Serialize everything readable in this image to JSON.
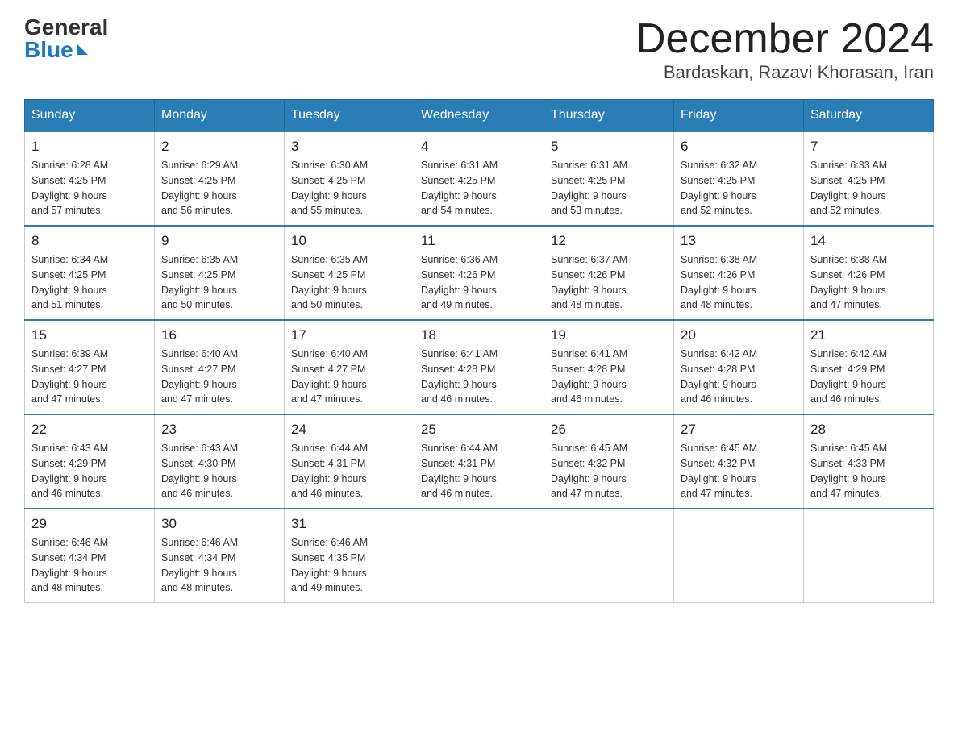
{
  "header": {
    "logo_general": "General",
    "logo_blue": "Blue",
    "month_title": "December 2024",
    "location": "Bardaskan, Razavi Khorasan, Iran"
  },
  "weekdays": [
    "Sunday",
    "Monday",
    "Tuesday",
    "Wednesday",
    "Thursday",
    "Friday",
    "Saturday"
  ],
  "weeks": [
    [
      {
        "day": "1",
        "sunrise": "6:28 AM",
        "sunset": "4:25 PM",
        "daylight": "9 hours and 57 minutes."
      },
      {
        "day": "2",
        "sunrise": "6:29 AM",
        "sunset": "4:25 PM",
        "daylight": "9 hours and 56 minutes."
      },
      {
        "day": "3",
        "sunrise": "6:30 AM",
        "sunset": "4:25 PM",
        "daylight": "9 hours and 55 minutes."
      },
      {
        "day": "4",
        "sunrise": "6:31 AM",
        "sunset": "4:25 PM",
        "daylight": "9 hours and 54 minutes."
      },
      {
        "day": "5",
        "sunrise": "6:31 AM",
        "sunset": "4:25 PM",
        "daylight": "9 hours and 53 minutes."
      },
      {
        "day": "6",
        "sunrise": "6:32 AM",
        "sunset": "4:25 PM",
        "daylight": "9 hours and 52 minutes."
      },
      {
        "day": "7",
        "sunrise": "6:33 AM",
        "sunset": "4:25 PM",
        "daylight": "9 hours and 52 minutes."
      }
    ],
    [
      {
        "day": "8",
        "sunrise": "6:34 AM",
        "sunset": "4:25 PM",
        "daylight": "9 hours and 51 minutes."
      },
      {
        "day": "9",
        "sunrise": "6:35 AM",
        "sunset": "4:25 PM",
        "daylight": "9 hours and 50 minutes."
      },
      {
        "day": "10",
        "sunrise": "6:35 AM",
        "sunset": "4:25 PM",
        "daylight": "9 hours and 50 minutes."
      },
      {
        "day": "11",
        "sunrise": "6:36 AM",
        "sunset": "4:26 PM",
        "daylight": "9 hours and 49 minutes."
      },
      {
        "day": "12",
        "sunrise": "6:37 AM",
        "sunset": "4:26 PM",
        "daylight": "9 hours and 48 minutes."
      },
      {
        "day": "13",
        "sunrise": "6:38 AM",
        "sunset": "4:26 PM",
        "daylight": "9 hours and 48 minutes."
      },
      {
        "day": "14",
        "sunrise": "6:38 AM",
        "sunset": "4:26 PM",
        "daylight": "9 hours and 47 minutes."
      }
    ],
    [
      {
        "day": "15",
        "sunrise": "6:39 AM",
        "sunset": "4:27 PM",
        "daylight": "9 hours and 47 minutes."
      },
      {
        "day": "16",
        "sunrise": "6:40 AM",
        "sunset": "4:27 PM",
        "daylight": "9 hours and 47 minutes."
      },
      {
        "day": "17",
        "sunrise": "6:40 AM",
        "sunset": "4:27 PM",
        "daylight": "9 hours and 47 minutes."
      },
      {
        "day": "18",
        "sunrise": "6:41 AM",
        "sunset": "4:28 PM",
        "daylight": "9 hours and 46 minutes."
      },
      {
        "day": "19",
        "sunrise": "6:41 AM",
        "sunset": "4:28 PM",
        "daylight": "9 hours and 46 minutes."
      },
      {
        "day": "20",
        "sunrise": "6:42 AM",
        "sunset": "4:28 PM",
        "daylight": "9 hours and 46 minutes."
      },
      {
        "day": "21",
        "sunrise": "6:42 AM",
        "sunset": "4:29 PM",
        "daylight": "9 hours and 46 minutes."
      }
    ],
    [
      {
        "day": "22",
        "sunrise": "6:43 AM",
        "sunset": "4:29 PM",
        "daylight": "9 hours and 46 minutes."
      },
      {
        "day": "23",
        "sunrise": "6:43 AM",
        "sunset": "4:30 PM",
        "daylight": "9 hours and 46 minutes."
      },
      {
        "day": "24",
        "sunrise": "6:44 AM",
        "sunset": "4:31 PM",
        "daylight": "9 hours and 46 minutes."
      },
      {
        "day": "25",
        "sunrise": "6:44 AM",
        "sunset": "4:31 PM",
        "daylight": "9 hours and 46 minutes."
      },
      {
        "day": "26",
        "sunrise": "6:45 AM",
        "sunset": "4:32 PM",
        "daylight": "9 hours and 47 minutes."
      },
      {
        "day": "27",
        "sunrise": "6:45 AM",
        "sunset": "4:32 PM",
        "daylight": "9 hours and 47 minutes."
      },
      {
        "day": "28",
        "sunrise": "6:45 AM",
        "sunset": "4:33 PM",
        "daylight": "9 hours and 47 minutes."
      }
    ],
    [
      {
        "day": "29",
        "sunrise": "6:46 AM",
        "sunset": "4:34 PM",
        "daylight": "9 hours and 48 minutes."
      },
      {
        "day": "30",
        "sunrise": "6:46 AM",
        "sunset": "4:34 PM",
        "daylight": "9 hours and 48 minutes."
      },
      {
        "day": "31",
        "sunrise": "6:46 AM",
        "sunset": "4:35 PM",
        "daylight": "9 hours and 49 minutes."
      },
      null,
      null,
      null,
      null
    ]
  ]
}
